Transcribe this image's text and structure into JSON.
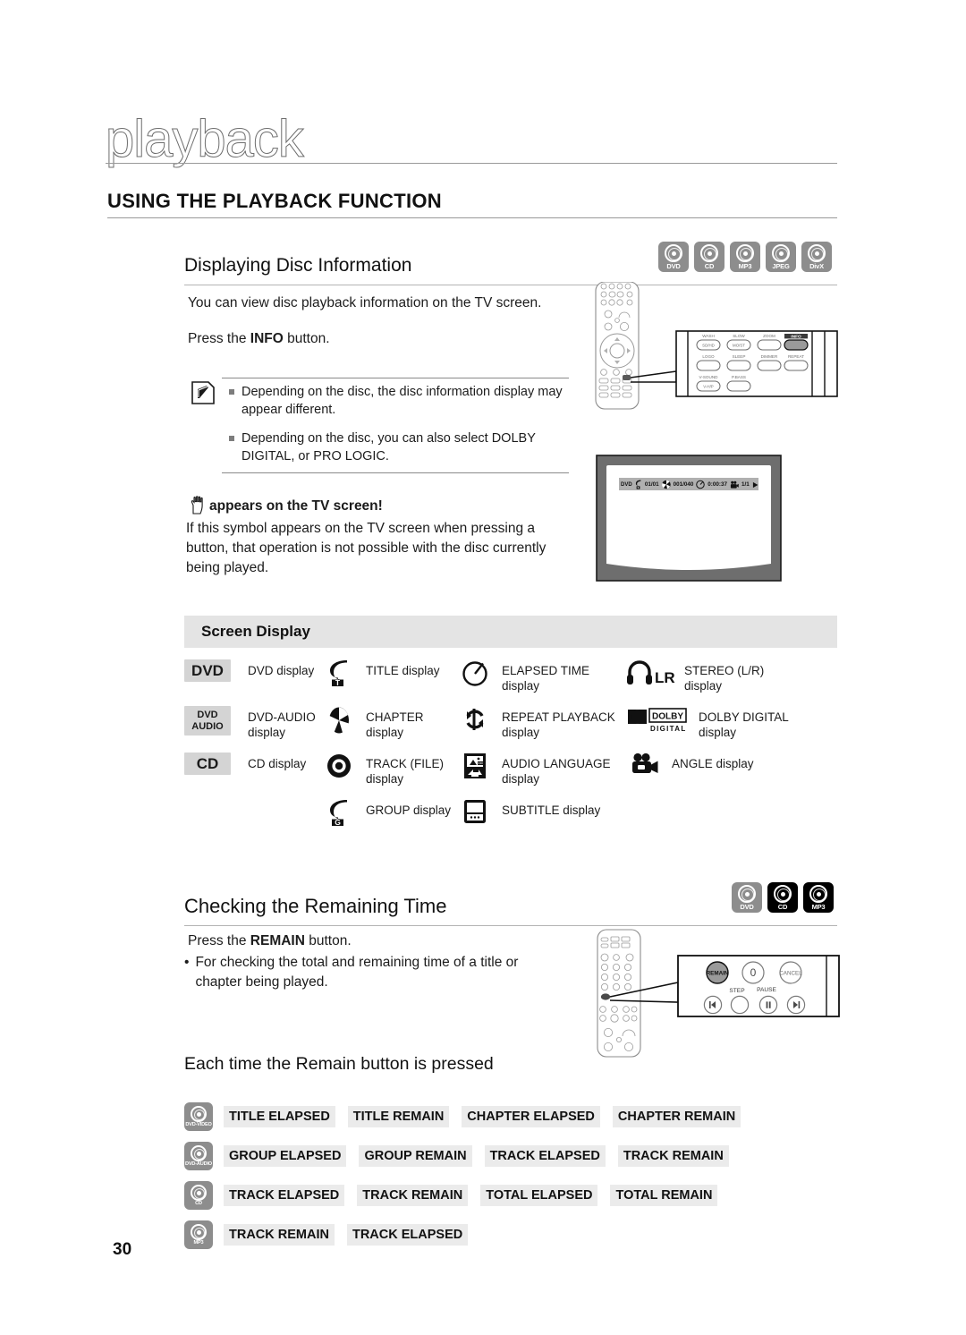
{
  "page": {
    "chapter_title": "playback",
    "section_title": "USING THE PLAYBACK FUNCTION",
    "page_number": "30"
  },
  "colors": {
    "badge_gray": "#8d8d8d",
    "badge_black": "#000000",
    "header_band": "#e4e4e4",
    "tag_gray": "#d4d4d4",
    "remain_item_gray": "#ebebeb",
    "osd_band": "#b0b0b0",
    "highlight_button": "#9a9a9a"
  },
  "sections": [
    {
      "id": "displaying-disc-information",
      "heading": "Displaying Disc Information",
      "badges": [
        {
          "label": "DVD",
          "icon": "disc-icon",
          "style": "gray"
        },
        {
          "label": "CD",
          "icon": "disc-icon",
          "style": "gray"
        },
        {
          "label": "MP3",
          "icon": "disc-icon",
          "style": "gray"
        },
        {
          "label": "JPEG",
          "icon": "disc-icon",
          "style": "gray"
        },
        {
          "label": "DivX",
          "icon": "disc-icon",
          "style": "gray"
        }
      ],
      "paragraphs": [
        "You can view disc playback information  on the TV screen.",
        "Press the INFO button."
      ],
      "press_prefix": "Press the ",
      "press_bold": "INFO",
      "press_suffix": " button."
    }
  ],
  "note": {
    "icon": "pencil-note-icon",
    "items": [
      "Depending on the disc, the disc information display may appear different.",
      "Depending on the disc, you can also select DOLBY DIGITAL, or PRO LOGIC."
    ]
  },
  "warning": {
    "icon": "hand-icon",
    "heading": "appears on the TV screen!",
    "body": "If this symbol appears on the TV screen when pressing a button, that operation is not possible with the disc currently being played."
  },
  "remote_info_panel": {
    "highlighted_button": "INFO",
    "rows": [
      [
        {
          "top": "WASH",
          "label": "SD/HD"
        },
        {
          "top": "SLOW",
          "label": "MO/ST"
        },
        {
          "top": "ZOOM",
          "label": ""
        },
        {
          "top": "INFO",
          "label": "",
          "highlight": true
        }
      ],
      [
        {
          "top": "LOGO",
          "label": ""
        },
        {
          "top": "SLEEP",
          "label": ""
        },
        {
          "top": "DIMMER",
          "label": ""
        },
        {
          "top": "REPEAT",
          "label": ""
        }
      ],
      [
        {
          "top": "V-SOUND",
          "label": "V-H/P"
        },
        {
          "top": "P.BASS",
          "label": ""
        }
      ]
    ]
  },
  "tv_osd": {
    "disc_type": "DVD",
    "fields": [
      {
        "icon": "title-icon",
        "value": "01/01"
      },
      {
        "icon": "chapter-icon",
        "value": "001/040"
      },
      {
        "icon": "clock-icon",
        "value": "0:00:37"
      },
      {
        "icon": "angle-icon",
        "value": "1/1"
      },
      {
        "icon": "play-icon",
        "value": ""
      }
    ]
  },
  "screen_display": {
    "header": "Screen Display",
    "rows": [
      {
        "tag": {
          "text": "DVD",
          "type": "single"
        },
        "cells": [
          {
            "icon": "tag-dvd",
            "label": "DVD display"
          },
          {
            "icon": "title-icon",
            "label": "TITLE display"
          },
          {
            "icon": "clock-icon",
            "label": "ELAPSED TIME display"
          },
          {
            "icon": "headphone-lr-icon",
            "label": "STEREO (L/R) display"
          }
        ]
      },
      {
        "tag": {
          "text": "DVD AUDIO",
          "type": "double"
        },
        "cells": [
          {
            "icon": "tag-dvd-audio",
            "label": "DVD-AUDIO display"
          },
          {
            "icon": "chapter-icon",
            "label": "CHAPTER display"
          },
          {
            "icon": "repeat-icon",
            "label": "REPEAT PLAYBACK display"
          },
          {
            "icon": "dolby-digital-icon",
            "label": "DOLBY DIGITAL display"
          }
        ]
      },
      {
        "tag": {
          "text": "CD",
          "type": "single"
        },
        "cells": [
          {
            "icon": "tag-cd",
            "label": "CD display"
          },
          {
            "icon": "track-icon",
            "label": "TRACK (FILE) display"
          },
          {
            "icon": "audio-language-icon",
            "label": "AUDIO LANGUAGE display"
          },
          {
            "icon": "angle-camera-icon",
            "label": "ANGLE display"
          }
        ]
      },
      {
        "tag": {
          "text": "",
          "type": "none"
        },
        "cells": [
          {
            "icon": "",
            "label": ""
          },
          {
            "icon": "group-icon",
            "label": "GROUP display"
          },
          {
            "icon": "subtitle-icon",
            "label": "SUBTITLE display"
          },
          {
            "icon": "",
            "label": ""
          }
        ]
      }
    ]
  },
  "remaining_time": {
    "heading": "Checking the Remaining Time",
    "badges": [
      {
        "label": "DVD",
        "icon": "disc-icon",
        "style": "gray"
      },
      {
        "label": "CD",
        "icon": "disc-icon",
        "style": "black"
      },
      {
        "label": "MP3",
        "icon": "disc-icon",
        "style": "black"
      }
    ],
    "press_prefix": "Press the ",
    "press_bold": "REMAIN",
    "press_suffix": " button.",
    "bullet": "For checking the total and remaining time of a title or chapter being played."
  },
  "remote_remain_panel": {
    "highlighted_button": "REMAIN",
    "row1": [
      {
        "label": "REMAIN",
        "highlight": true
      },
      {
        "label": "0"
      },
      {
        "label": "CANCEL"
      }
    ],
    "row2_top": [
      "",
      "STEP",
      "PAUSE",
      ""
    ],
    "row2": [
      {
        "icon": "skip-back-icon"
      },
      {
        "icon": "step-icon"
      },
      {
        "icon": "pause-icon"
      },
      {
        "icon": "skip-forward-icon"
      }
    ]
  },
  "remain_table": {
    "title": "Each time the Remain button is pressed",
    "rows": [
      {
        "badge": {
          "label": "DVD-VIDEO",
          "style": "gray"
        },
        "items": [
          "TITLE ELAPSED",
          "TITLE REMAIN",
          "CHAPTER ELAPSED",
          "CHAPTER REMAIN"
        ]
      },
      {
        "badge": {
          "label": "DVD-AUDIO",
          "style": "gray"
        },
        "items": [
          "GROUP ELAPSED",
          "GROUP REMAIN",
          "TRACK ELAPSED",
          "TRACK REMAIN"
        ]
      },
      {
        "badge": {
          "label": "CD",
          "style": "gray"
        },
        "items": [
          "TRACK ELAPSED",
          "TRACK REMAIN",
          "TOTAL ELAPSED",
          "TOTAL REMAIN"
        ]
      },
      {
        "badge": {
          "label": "MP3",
          "style": "gray"
        },
        "items": [
          "TRACK REMAIN",
          "TRACK ELAPSED"
        ]
      }
    ]
  }
}
